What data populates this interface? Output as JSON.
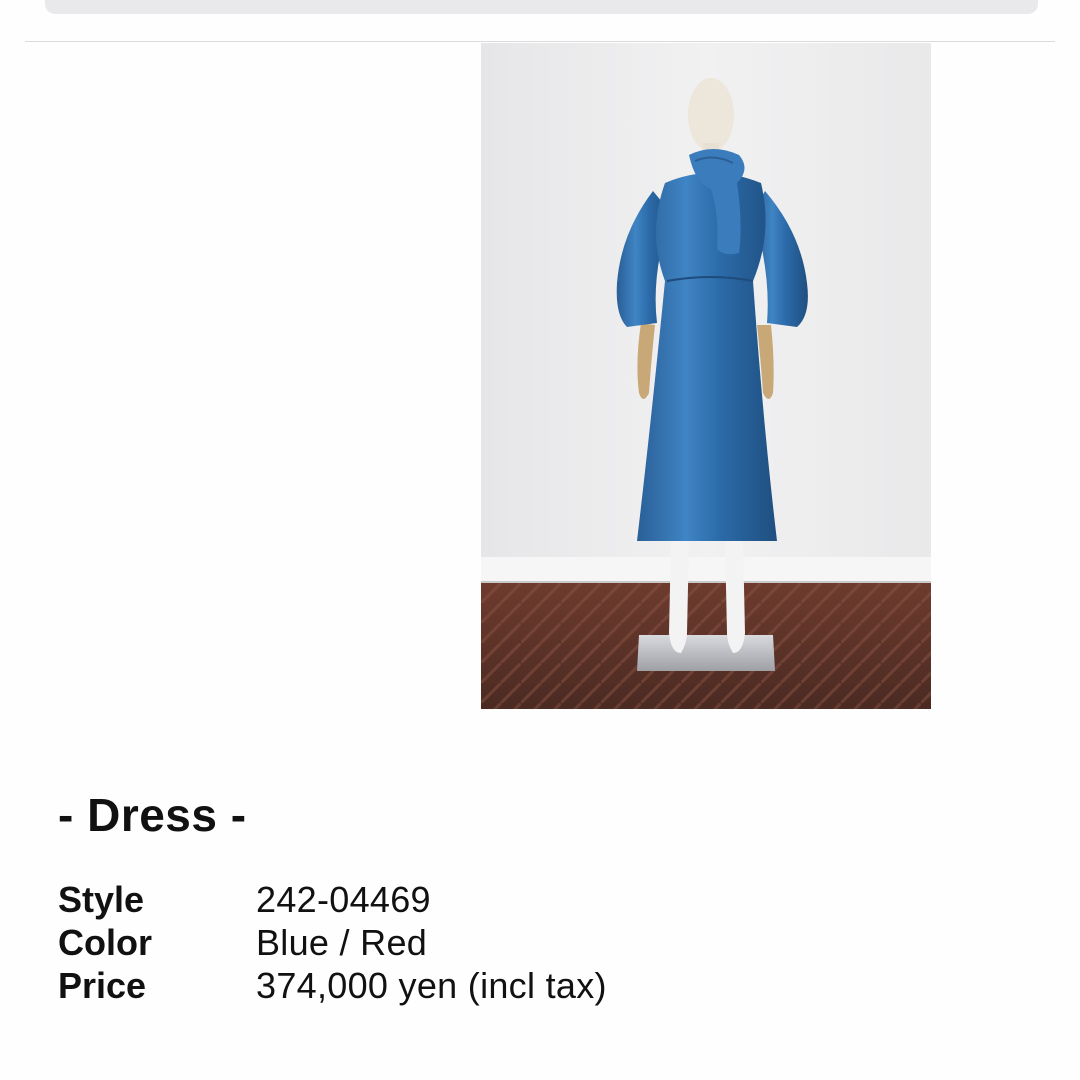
{
  "product": {
    "title": "- Dress -",
    "image": {
      "subject": "mannequin-dress-photo",
      "dress_color": "#2f6fae"
    },
    "details": [
      {
        "label": "Style",
        "value": "242-04469"
      },
      {
        "label": "Color",
        "value": "Blue / Red"
      },
      {
        "label": "Price",
        "value": "374,000 yen (incl tax)"
      }
    ]
  },
  "colors": {
    "background": "#fefefe",
    "text": "#111111",
    "top_bar": "#e9e9eb",
    "divider": "#dadada"
  }
}
